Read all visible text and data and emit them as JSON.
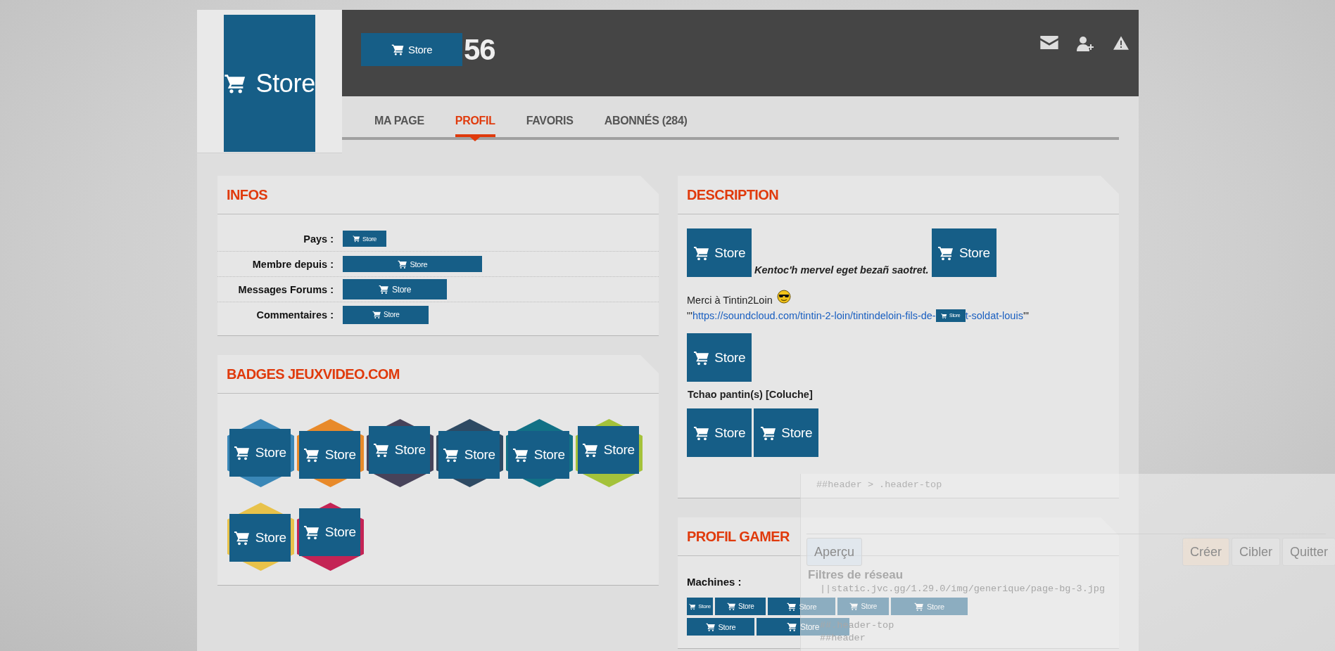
{
  "header": {
    "avatar": {
      "label": "Store"
    },
    "name_logo": {
      "label": "Store"
    },
    "name_suffix": "56"
  },
  "tabs": [
    {
      "label": "MA PAGE",
      "selected": false
    },
    {
      "label": "PROFIL",
      "selected": true
    },
    {
      "label": "FAVORIS",
      "selected": false
    },
    {
      "label": "ABONNÉS (284)",
      "selected": false
    }
  ],
  "infos": {
    "title": "INFOS",
    "rows": [
      {
        "label": "Pays :",
        "image": {
          "label": "Store"
        }
      },
      {
        "label": "Membre depuis :",
        "image": {
          "label": "Store"
        }
      },
      {
        "label": "Messages Forums :",
        "image": {
          "label": "Store"
        }
      },
      {
        "label": "Commentaires :",
        "image": {
          "label": "Store"
        }
      }
    ]
  },
  "badges": {
    "title": "BADGES JEUXVIDEO.COM",
    "items": [
      {
        "color": "#3a87b7",
        "image": {
          "label": "Store"
        }
      },
      {
        "color": "#e88a2a",
        "image": {
          "label": "Store"
        }
      },
      {
        "color": "#47435a",
        "image": {
          "label": "Store"
        }
      },
      {
        "color": "#2e4a63",
        "image": {
          "label": "Store"
        }
      },
      {
        "color": "#127186",
        "image": {
          "label": "Store"
        }
      },
      {
        "color": "#a4c23a",
        "image": {
          "label": "Store"
        }
      },
      {
        "color": "#e8c24a",
        "image": {
          "label": "Store"
        }
      },
      {
        "color": "#c42455",
        "image": {
          "label": "Store"
        }
      }
    ]
  },
  "description": {
    "title": "DESCRIPTION",
    "blocks": [
      {
        "kind": "quote",
        "before": {
          "label": "Store"
        },
        "text": "Kentoc'h mervel eget bezañ saotret.",
        "after": {
          "label": "Store"
        }
      },
      {
        "kind": "thanks",
        "text": "Merci à Tintin2Loin",
        "link_open": "\"'",
        "link_start": "https://soundcloud.com/tintin-2-loin/tintindeloin-fils-de-",
        "inline_image": {
          "label": "Store"
        },
        "link_end": "t-soldat-louis",
        "link_close": "'\""
      },
      {
        "kind": "images",
        "images": [
          {
            "label": "Store"
          }
        ]
      },
      {
        "kind": "bold",
        "text": "Tchao pantin(s) [Coluche]"
      },
      {
        "kind": "images",
        "images": [
          {
            "label": "Store"
          },
          {
            "label": "Store"
          }
        ]
      }
    ]
  },
  "profil_gamer": {
    "title": "PROFIL GAMER",
    "machines_label": "Machines :",
    "machines": [
      {
        "label": "Store"
      },
      {
        "label": "Store"
      },
      {
        "label": "Store"
      },
      {
        "label": "Store"
      },
      {
        "label": "Store"
      },
      {
        "label": "Store"
      },
      {
        "label": "Store"
      }
    ]
  },
  "picker": {
    "filter": "##header > .header-top",
    "preview_button": "Aperçu",
    "actions": [
      {
        "label": "Créer"
      },
      {
        "label": "Cibler"
      },
      {
        "label": "Quitter"
      }
    ],
    "network_title": "Filtres de réseau",
    "filters": [
      "||static.jvc.gg/1.29.0/img/generique/page-bg-3.jpg",
      "##.header-top",
      "##header"
    ]
  }
}
